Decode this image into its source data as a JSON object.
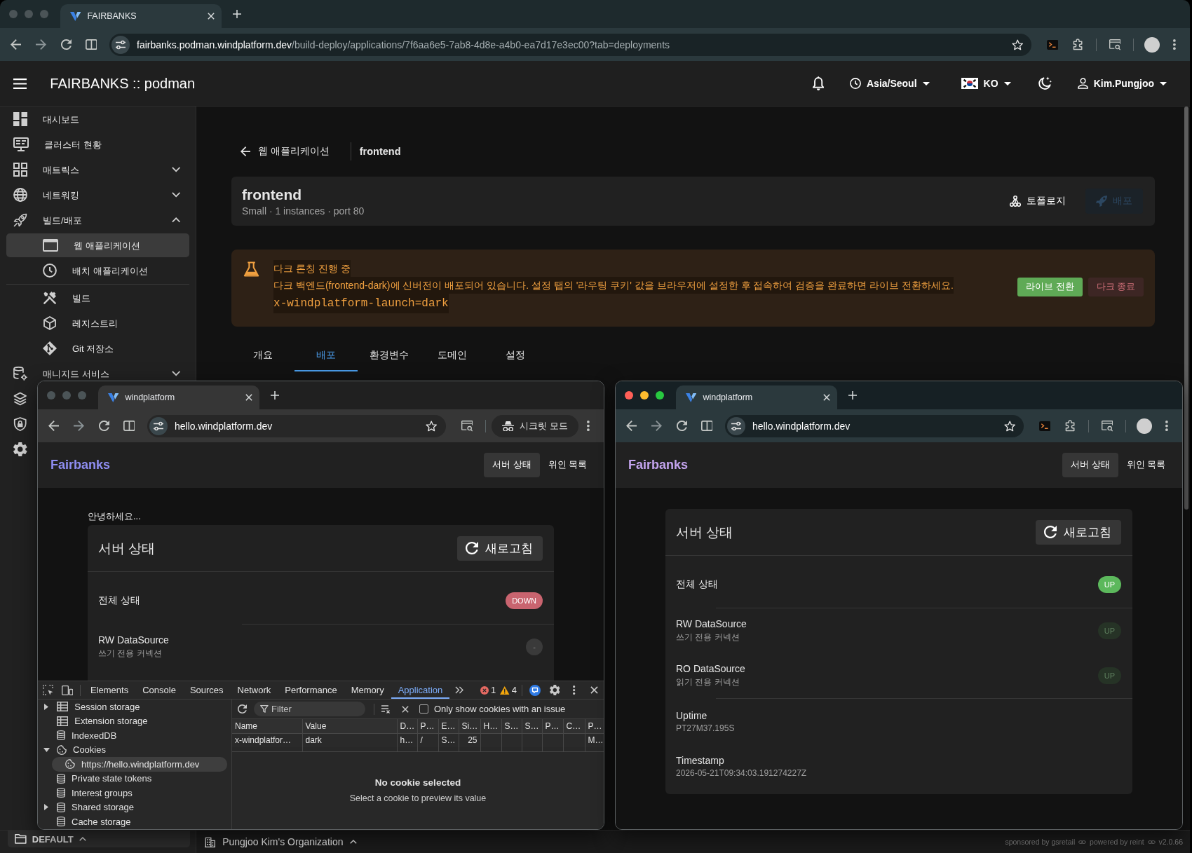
{
  "browser": {
    "focused": false,
    "tabs": [
      {
        "title": "FAIRBANKS",
        "selected": true
      }
    ],
    "address": {
      "host": "fairbanks.podman.windplatform.dev",
      "path": "/build-deploy/applications/7f6aa6e5-7ab8-4d8e-a4b0-ea7d17e3ec00?tab=deployments"
    }
  },
  "header": {
    "title": "FAIRBANKS :: podman",
    "timezone": "Asia/Seoul",
    "language": "KO",
    "user": "Kim.Pungjoo"
  },
  "sidebar": {
    "items": [
      {
        "label": "대시보드",
        "kind": "link",
        "selected": false
      },
      {
        "label": "클러스터 현황",
        "kind": "link",
        "selected": false
      },
      {
        "label": "매트릭스",
        "kind": "group",
        "expanded": false,
        "selected": false
      },
      {
        "label": "네트워킹",
        "kind": "group",
        "expanded": false,
        "selected": false
      },
      {
        "label": "빌드/배포",
        "kind": "group",
        "expanded": true,
        "selected": false,
        "children": [
          {
            "label": "웹 애플리케이션",
            "selected": true
          },
          {
            "label": "배치 애플리케이션",
            "selected": false
          },
          {
            "label": "빌드",
            "selected": false,
            "divider_above": true
          },
          {
            "label": "레지스트리",
            "selected": false
          },
          {
            "label": "Git 저장소",
            "selected": false
          }
        ]
      },
      {
        "label": "매니지드 서비스",
        "kind": "group",
        "expanded": false,
        "selected": false
      },
      {
        "kind": "icon",
        "selected": false
      },
      {
        "kind": "icon",
        "selected": false
      },
      {
        "kind": "icon",
        "selected": false
      }
    ]
  },
  "breadcrumb": {
    "parent": "웹 애플리케이션",
    "current": "frontend"
  },
  "application": {
    "name": "frontend",
    "summary": "Small · 1 instances · port 80",
    "actions": [
      {
        "label": "토폴로지",
        "kind": "text",
        "disabled": false
      },
      {
        "label": "배포",
        "kind": "filled",
        "disabled": true
      }
    ]
  },
  "alert": {
    "title": "다크 론칭 진행 중",
    "message": "다크 백엔드(frontend-dark)에 신버전이 배포되어 있습니다. 설정 탭의 '라우팅 쿠키' 값을 브라우저에 설정한 후 접속하여 검증을 완료하면 라이브 전환하세요.",
    "code": "x-windplatform-launch=dark",
    "actions": [
      {
        "label": "라이브 전환",
        "kind": "confirm"
      },
      {
        "label": "다크 종료",
        "kind": "danger"
      }
    ]
  },
  "tabs": [
    {
      "label": "개요",
      "selected": false
    },
    {
      "label": "배포",
      "selected": true
    },
    {
      "label": "환경변수",
      "selected": false
    },
    {
      "label": "도메인",
      "selected": false
    },
    {
      "label": "설정",
      "selected": false
    }
  ],
  "windows": [
    {
      "focused": false,
      "tabs": [
        {
          "title": "windplatform",
          "selected": true
        }
      ],
      "address": {
        "host": "hello.windplatform.dev"
      },
      "incognito": {
        "label": "시크릿 모드"
      },
      "page": {
        "brand": {
          "text": "Fairbanks",
          "color": "#8f8ef2"
        },
        "nav": [
          {
            "label": "서버 상태",
            "selected": true
          },
          {
            "label": "위인 목록",
            "selected": false
          }
        ],
        "greeting": "안녕하세요...",
        "card": {
          "title": "서버 상태",
          "refresh": "새로고침",
          "rows": [
            {
              "kind": "status",
              "label": "전체 상태",
              "badge": {
                "text": "DOWN",
                "color": "#c9646f"
              }
            },
            {
              "kind": "datasource",
              "label": "RW DataSource",
              "description": "쓰기 전용 커넥션",
              "badge": {
                "text": "-",
                "color": "#3a3a3a"
              }
            }
          ]
        }
      },
      "devtools": {
        "tabs": [
          {
            "label": "Elements",
            "selected": false
          },
          {
            "label": "Console",
            "selected": false
          },
          {
            "label": "Sources",
            "selected": false
          },
          {
            "label": "Network",
            "selected": false
          },
          {
            "label": "Performance",
            "selected": false
          },
          {
            "label": "Memory",
            "selected": false
          },
          {
            "label": "Application",
            "selected": true
          }
        ],
        "issues": {
          "errors": "1",
          "warnings": "4"
        },
        "tree": [
          {
            "label": "Session storage",
            "kind": "table",
            "expanded": false,
            "selected": false
          },
          {
            "label": "Extension storage",
            "kind": "table",
            "selected": false
          },
          {
            "label": "IndexedDB",
            "kind": "database",
            "selected": false
          },
          {
            "label": "Cookies",
            "kind": "cookie",
            "expanded": true,
            "selected": false,
            "children": [
              {
                "label": "https://hello.windplatform.dev",
                "kind": "cookie",
                "selected": true
              }
            ]
          },
          {
            "label": "Private state tokens",
            "kind": "database",
            "selected": false
          },
          {
            "label": "Interest groups",
            "kind": "database",
            "selected": false
          },
          {
            "label": "Shared storage",
            "kind": "database",
            "expanded": false,
            "selected": false
          },
          {
            "label": "Cache storage",
            "kind": "database",
            "selected": false
          }
        ],
        "filter": {
          "placeholder": "Filter"
        },
        "issue_filter": {
          "label": "Only show cookies with an issue",
          "checked": false
        },
        "table": {
          "columns": [
            "Name",
            "Value",
            "D…",
            "P…",
            "E…",
            "Si…",
            "H…",
            "S…",
            "S…",
            "P…",
            "C…",
            "P…"
          ],
          "rows": [
            {
              "selected": false,
              "cells": [
                "x-windplatfor…",
                "dark",
                "h…",
                "/",
                "S…",
                "25",
                null,
                null,
                null,
                null,
                null,
                "M…"
              ]
            }
          ]
        },
        "preview": {
          "title": "No cookie selected",
          "hint": "Select a cookie to preview its value"
        }
      }
    },
    {
      "focused": true,
      "tabs": [
        {
          "title": "windplatform",
          "selected": true
        }
      ],
      "address": {
        "host": "hello.windplatform.dev"
      },
      "page": {
        "brand": {
          "text": "Fairbanks",
          "color": "#c4a4ee"
        },
        "nav": [
          {
            "label": "서버 상태",
            "selected": true
          },
          {
            "label": "위인 목록",
            "selected": false
          }
        ],
        "card": {
          "title": "서버 상태",
          "refresh": "새로고침",
          "rows": [
            {
              "kind": "status",
              "label": "전체 상태",
              "badge": {
                "text": "UP",
                "color": "#5cb85c"
              }
            },
            {
              "kind": "datasource",
              "label": "RW DataSource",
              "description": "쓰기 전용 커넥션",
              "badge": {
                "text": "UP",
                "color": "#263326"
              }
            },
            {
              "kind": "datasource",
              "label": "RO DataSource",
              "description": "읽기 전용 커넥션",
              "badge": {
                "text": "UP",
                "color": "#263326"
              }
            },
            {
              "kind": "info",
              "label": "Uptime",
              "description": "PT27M37.195S"
            },
            {
              "kind": "info",
              "label": "Timestamp",
              "description": "2026-05-21T09:34:03.191274227Z"
            }
          ]
        }
      }
    }
  ],
  "footer": {
    "workspace": "DEFAULT",
    "organization": "Pungjoo Kim's Organization",
    "credits": [
      "sponsored by gsretail",
      "powered by reint",
      "v2.0.66"
    ]
  }
}
